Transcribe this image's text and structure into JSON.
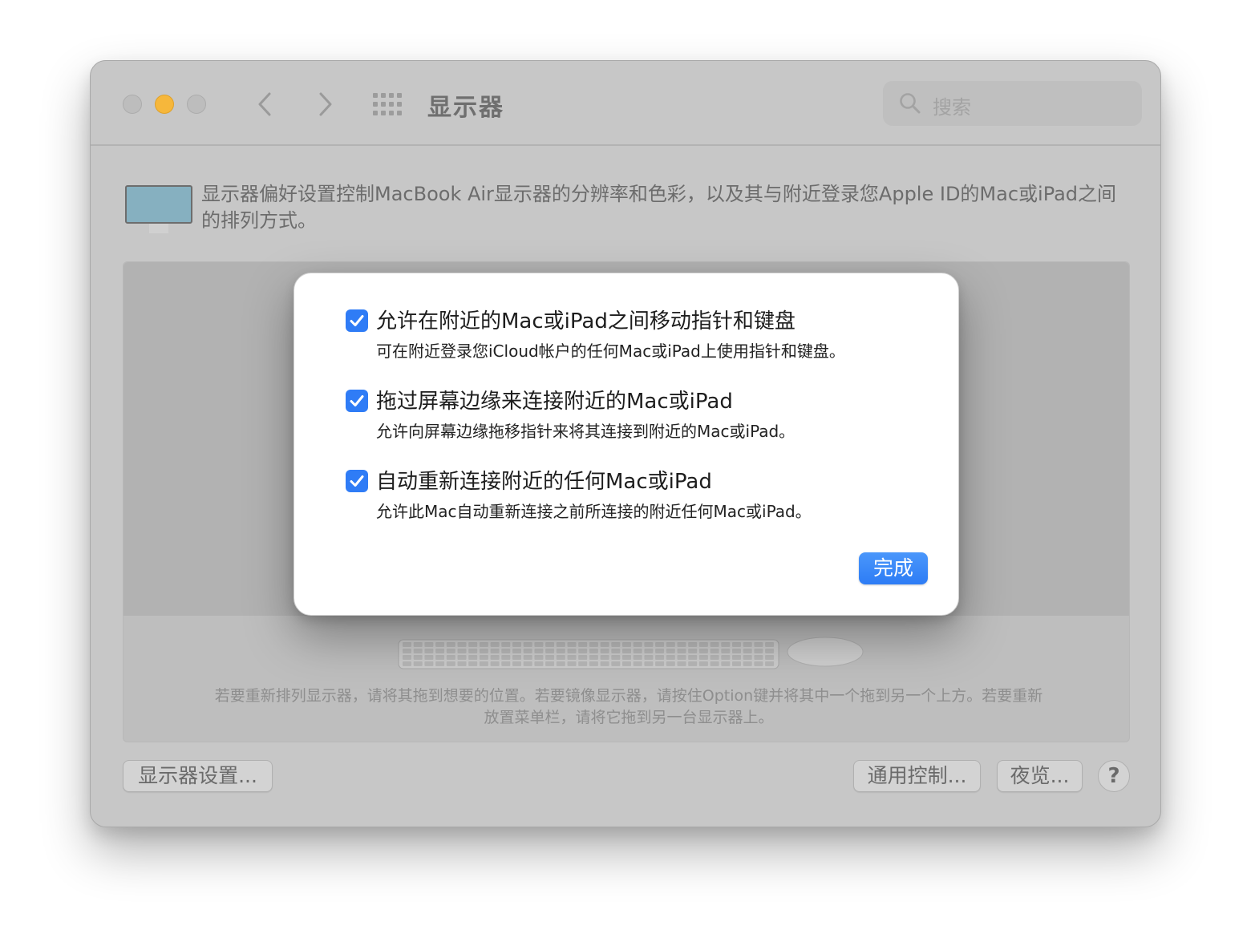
{
  "window": {
    "title": "显示器",
    "search_placeholder": "搜索"
  },
  "intro_text": "显示器偏好设置控制MacBook Air显示器的分辨率和色彩，以及其与附近登录您Apple ID的Mac或iPad之间的排列方式。",
  "arrangement_hint": "若要重新排列显示器，请将其拖到想要的位置。若要镜像显示器，请按住Option键并将其中一个拖到另一个上方。若要重新放置菜单栏，请将它拖到另一台显示器上。",
  "buttons": {
    "display_settings": "显示器设置...",
    "universal_control": "通用控制...",
    "night_shift": "夜览...",
    "help": "?"
  },
  "sheet": {
    "options": [
      {
        "label": "允许在附近的Mac或iPad之间移动指针和键盘",
        "description": "可在附近登录您iCloud帐户的任何Mac或iPad上使用指针和键盘。",
        "checked": true
      },
      {
        "label": "拖过屏幕边缘来连接附近的Mac或iPad",
        "description": "允许向屏幕边缘拖移指针来将其连接到附近的Mac或iPad。",
        "checked": true
      },
      {
        "label": "自动重新连接附近的任何Mac或iPad",
        "description": "允许此Mac自动重新连接之前所连接的附近任何Mac或iPad。",
        "checked": true
      }
    ],
    "done_label": "完成"
  },
  "colors": {
    "accent": "#2f7cf6",
    "minimize_light": "#f6b73b",
    "window_bg": "#c7c7c7"
  },
  "icons": [
    "close-light",
    "minimize-light",
    "zoom-light",
    "back-chevron-icon",
    "forward-chevron-icon",
    "grid-icon",
    "search-icon",
    "monitor-icon",
    "checkmark-icon",
    "keyboard-icon",
    "mouse-icon"
  ]
}
